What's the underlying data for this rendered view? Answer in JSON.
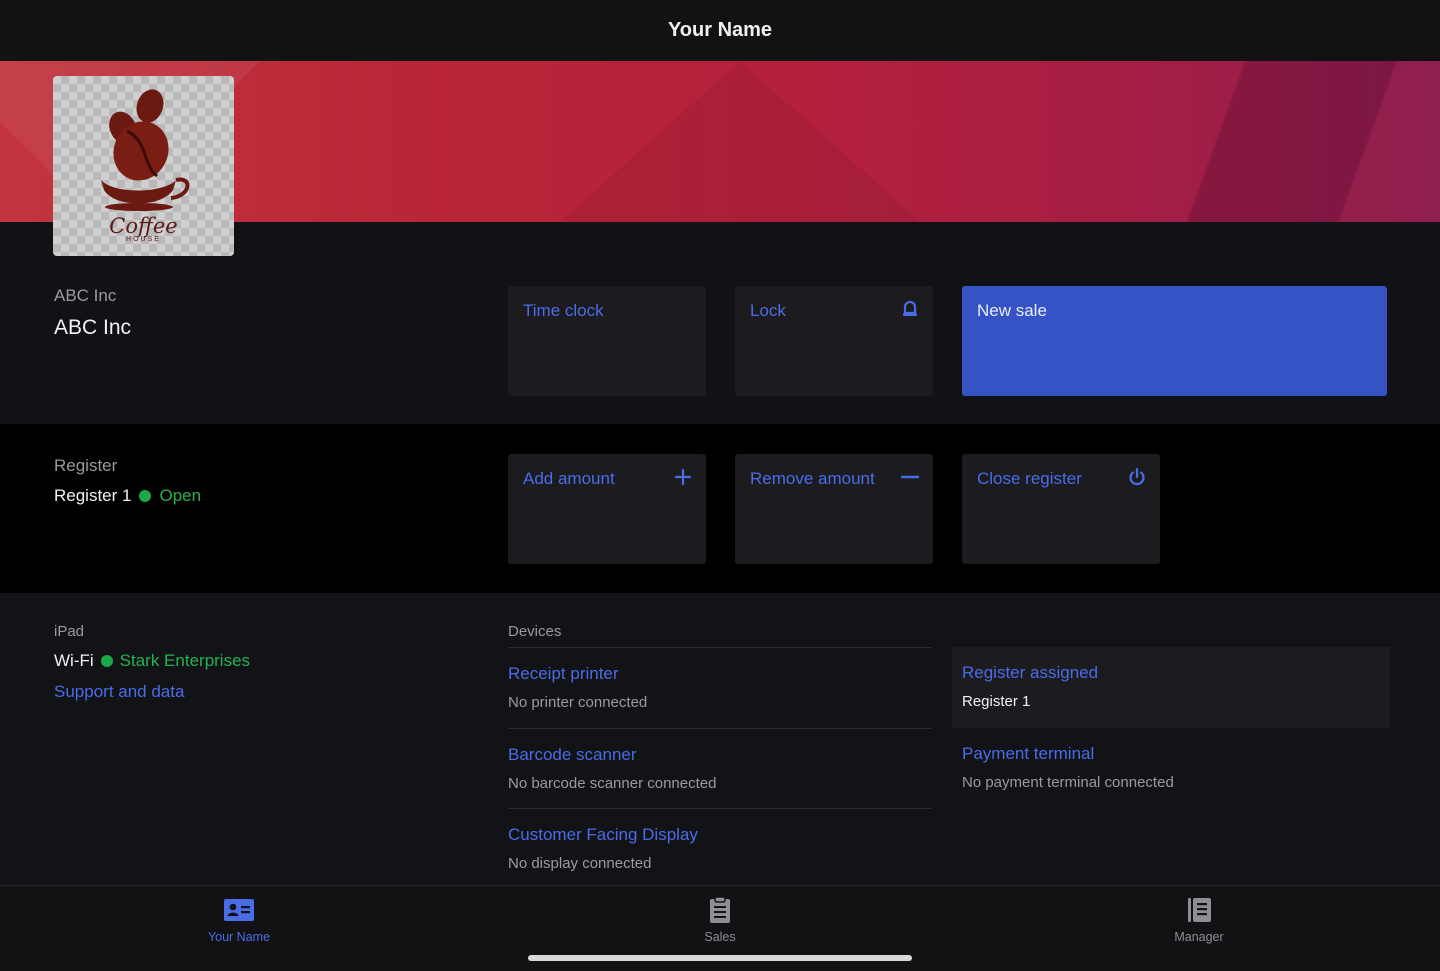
{
  "header": {
    "title": "Your Name"
  },
  "logo": {
    "text": "Coffee",
    "subtext": "HOUSE"
  },
  "company": {
    "label": "ABC Inc",
    "name": "ABC Inc"
  },
  "actions": {
    "time_clock": "Time clock",
    "lock": "Lock",
    "new_sale": "New sale"
  },
  "register": {
    "label": "Register",
    "name": "Register 1",
    "status": "Open",
    "add_amount": "Add amount",
    "remove_amount": "Remove amount",
    "close_register": "Close register"
  },
  "ipad": {
    "label": "iPad",
    "wifi_label": "Wi-Fi",
    "network": "Stark Enterprises",
    "support_link": "Support and data"
  },
  "devices": {
    "label": "Devices",
    "receipt_printer": {
      "title": "Receipt printer",
      "status": "No printer connected"
    },
    "barcode_scanner": {
      "title": "Barcode scanner",
      "status": "No barcode scanner connected"
    },
    "customer_display": {
      "title": "Customer Facing Display",
      "status": "No display connected"
    },
    "register_assigned": {
      "title": "Register assigned",
      "value": "Register 1"
    },
    "payment_terminal": {
      "title": "Payment terminal",
      "status": "No payment terminal connected"
    }
  },
  "tabs": [
    {
      "label": "Your Name",
      "icon": "id-card-icon",
      "active": true
    },
    {
      "label": "Sales",
      "icon": "clipboard-icon",
      "active": false
    },
    {
      "label": "Manager",
      "icon": "book-icon",
      "active": false
    }
  ],
  "colors": {
    "accent": "#4a6ce6",
    "primary_button": "#3553c4",
    "status_green": "#27b14f",
    "banner_red": "#b92537"
  }
}
